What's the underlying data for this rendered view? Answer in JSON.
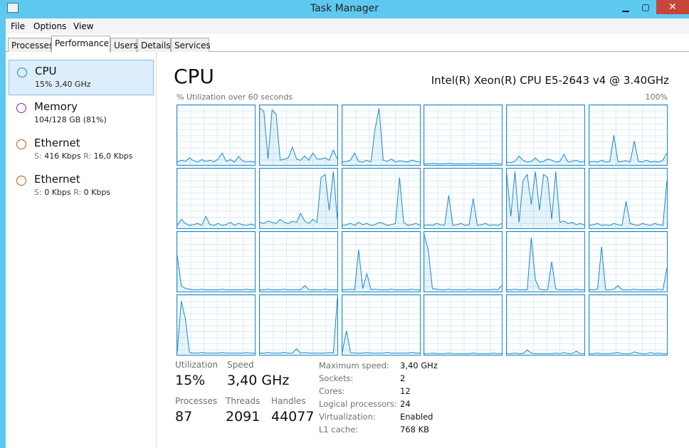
{
  "window": {
    "title": "Task Manager",
    "minimize": "▁",
    "maximize": "▢",
    "close": "✕"
  },
  "menu": [
    "File",
    "Options",
    "View"
  ],
  "tabs": [
    "Processes",
    "Performance",
    "Users",
    "Details",
    "Services"
  ],
  "sidebar": [
    {
      "name": "CPU",
      "sub": "15% 3,40 GHz",
      "color": "#1a8ac8"
    },
    {
      "name": "Memory",
      "sub": "104/128 GB (81%)",
      "color": "#8b1fb4"
    },
    {
      "name": "Ethernet",
      "s_label": "S:",
      "s": "416 Kbps",
      "r_label": "R:",
      "r": "16,0 Kbps",
      "color": "#b35a1a"
    },
    {
      "name": "Ethernet",
      "s_label": "S:",
      "s": "0 Kbps",
      "r_label": "R:",
      "r": "0 Kbps",
      "color": "#b35a1a"
    }
  ],
  "main": {
    "title": "CPU",
    "cpu_name": "Intel(R) Xeon(R) CPU E5-2643 v4 @ 3.40GHz",
    "util_label": "% Utilization over 60 seconds",
    "util_max": "100%"
  },
  "cores": [
    [
      5,
      8,
      6,
      12,
      7,
      5,
      9,
      6,
      8,
      5,
      10,
      20,
      6,
      9,
      5,
      14,
      7,
      5,
      6,
      5
    ],
    [
      95,
      90,
      10,
      92,
      85,
      8,
      10,
      12,
      30,
      10,
      8,
      15,
      8,
      20,
      10,
      10,
      12,
      8,
      25,
      10
    ],
    [
      5,
      6,
      8,
      20,
      6,
      5,
      8,
      5,
      60,
      95,
      8,
      6,
      10,
      5,
      7,
      6,
      5,
      8,
      6,
      5
    ],
    [
      2,
      2,
      3,
      2,
      2,
      2,
      3,
      2,
      2,
      2,
      2,
      2,
      3,
      2,
      2,
      2,
      2,
      3,
      2,
      2
    ],
    [
      5,
      4,
      6,
      15,
      8,
      5,
      6,
      12,
      5,
      6,
      10,
      8,
      5,
      6,
      18,
      5,
      6,
      8,
      5,
      6
    ],
    [
      5,
      6,
      5,
      8,
      5,
      6,
      50,
      5,
      6,
      7,
      5,
      40,
      6,
      5,
      8,
      5,
      6,
      5,
      8,
      20
    ],
    [
      5,
      15,
      8,
      5,
      6,
      8,
      5,
      20,
      6,
      5,
      8,
      5,
      6,
      10,
      5,
      8,
      6,
      5,
      7,
      5
    ],
    [
      10,
      8,
      12,
      10,
      8,
      15,
      10,
      8,
      12,
      10,
      25,
      12,
      8,
      15,
      10,
      85,
      90,
      30,
      95,
      15
    ],
    [
      5,
      6,
      8,
      5,
      10,
      6,
      8,
      5,
      6,
      10,
      8,
      5,
      6,
      8,
      85,
      10,
      5,
      6,
      8,
      5
    ],
    [
      5,
      6,
      5,
      8,
      6,
      5,
      55,
      5,
      6,
      8,
      5,
      6,
      50,
      5,
      6,
      8,
      5,
      6,
      5,
      8
    ],
    [
      90,
      20,
      95,
      10,
      80,
      90,
      40,
      95,
      30,
      90,
      85,
      15,
      95,
      10,
      12,
      8,
      10,
      6,
      8,
      5
    ],
    [
      5,
      6,
      8,
      5,
      6,
      5,
      8,
      6,
      5,
      45,
      8,
      6,
      5,
      8,
      6,
      5,
      8,
      6,
      5,
      80
    ],
    [
      60,
      10,
      5,
      4,
      3,
      3,
      4,
      3,
      3,
      3,
      3,
      4,
      3,
      3,
      3,
      3,
      3,
      4,
      3,
      3
    ],
    [
      3,
      3,
      4,
      3,
      3,
      3,
      4,
      3,
      3,
      3,
      3,
      10,
      3,
      3,
      3,
      3,
      4,
      3,
      3,
      3
    ],
    [
      3,
      3,
      4,
      3,
      70,
      5,
      30,
      3,
      4,
      3,
      3,
      3,
      4,
      3,
      3,
      3,
      3,
      4,
      3,
      3
    ],
    [
      95,
      70,
      5,
      4,
      3,
      3,
      4,
      3,
      3,
      3,
      3,
      4,
      3,
      3,
      3,
      3,
      3,
      4,
      3,
      10
    ],
    [
      3,
      3,
      4,
      3,
      3,
      3,
      90,
      20,
      4,
      3,
      3,
      50,
      4,
      3,
      3,
      3,
      3,
      4,
      3,
      3
    ],
    [
      3,
      3,
      4,
      75,
      3,
      3,
      4,
      10,
      3,
      3,
      3,
      4,
      3,
      3,
      3,
      3,
      3,
      4,
      3,
      40
    ],
    [
      5,
      90,
      60,
      4,
      3,
      3,
      4,
      3,
      3,
      3,
      3,
      4,
      3,
      3,
      3,
      3,
      3,
      4,
      3,
      3
    ],
    [
      3,
      3,
      4,
      3,
      3,
      3,
      4,
      3,
      3,
      10,
      3,
      4,
      3,
      3,
      3,
      3,
      3,
      4,
      3,
      95
    ],
    [
      5,
      40,
      4,
      3,
      3,
      3,
      4,
      3,
      3,
      3,
      3,
      4,
      3,
      3,
      3,
      3,
      3,
      4,
      3,
      3
    ],
    [
      2,
      2,
      3,
      2,
      2,
      2,
      3,
      2,
      2,
      2,
      2,
      2,
      3,
      2,
      2,
      2,
      2,
      3,
      2,
      2
    ],
    [
      2,
      2,
      3,
      2,
      2,
      8,
      3,
      2,
      2,
      2,
      2,
      2,
      3,
      2,
      4,
      2,
      2,
      6,
      2,
      2
    ],
    [
      2,
      2,
      3,
      2,
      2,
      2,
      3,
      4,
      2,
      2,
      2,
      5,
      3,
      2,
      2,
      4,
      2,
      3,
      2,
      2
    ]
  ],
  "stats": {
    "utilization_label": "Utilization",
    "utilization": "15%",
    "speed_label": "Speed",
    "speed": "3,40 GHz",
    "processes_label": "Processes",
    "processes": "87",
    "threads_label": "Threads",
    "threads": "2091",
    "handles_label": "Handles",
    "handles": "44077"
  },
  "details": [
    {
      "k": "Maximum speed:",
      "v": "3,40 GHz"
    },
    {
      "k": "Sockets:",
      "v": "2"
    },
    {
      "k": "Cores:",
      "v": "12"
    },
    {
      "k": "Logical processors:",
      "v": "24"
    },
    {
      "k": "Virtualization:",
      "v": "Enabled"
    },
    {
      "k": "L1 cache:",
      "v": "768 KB"
    }
  ]
}
